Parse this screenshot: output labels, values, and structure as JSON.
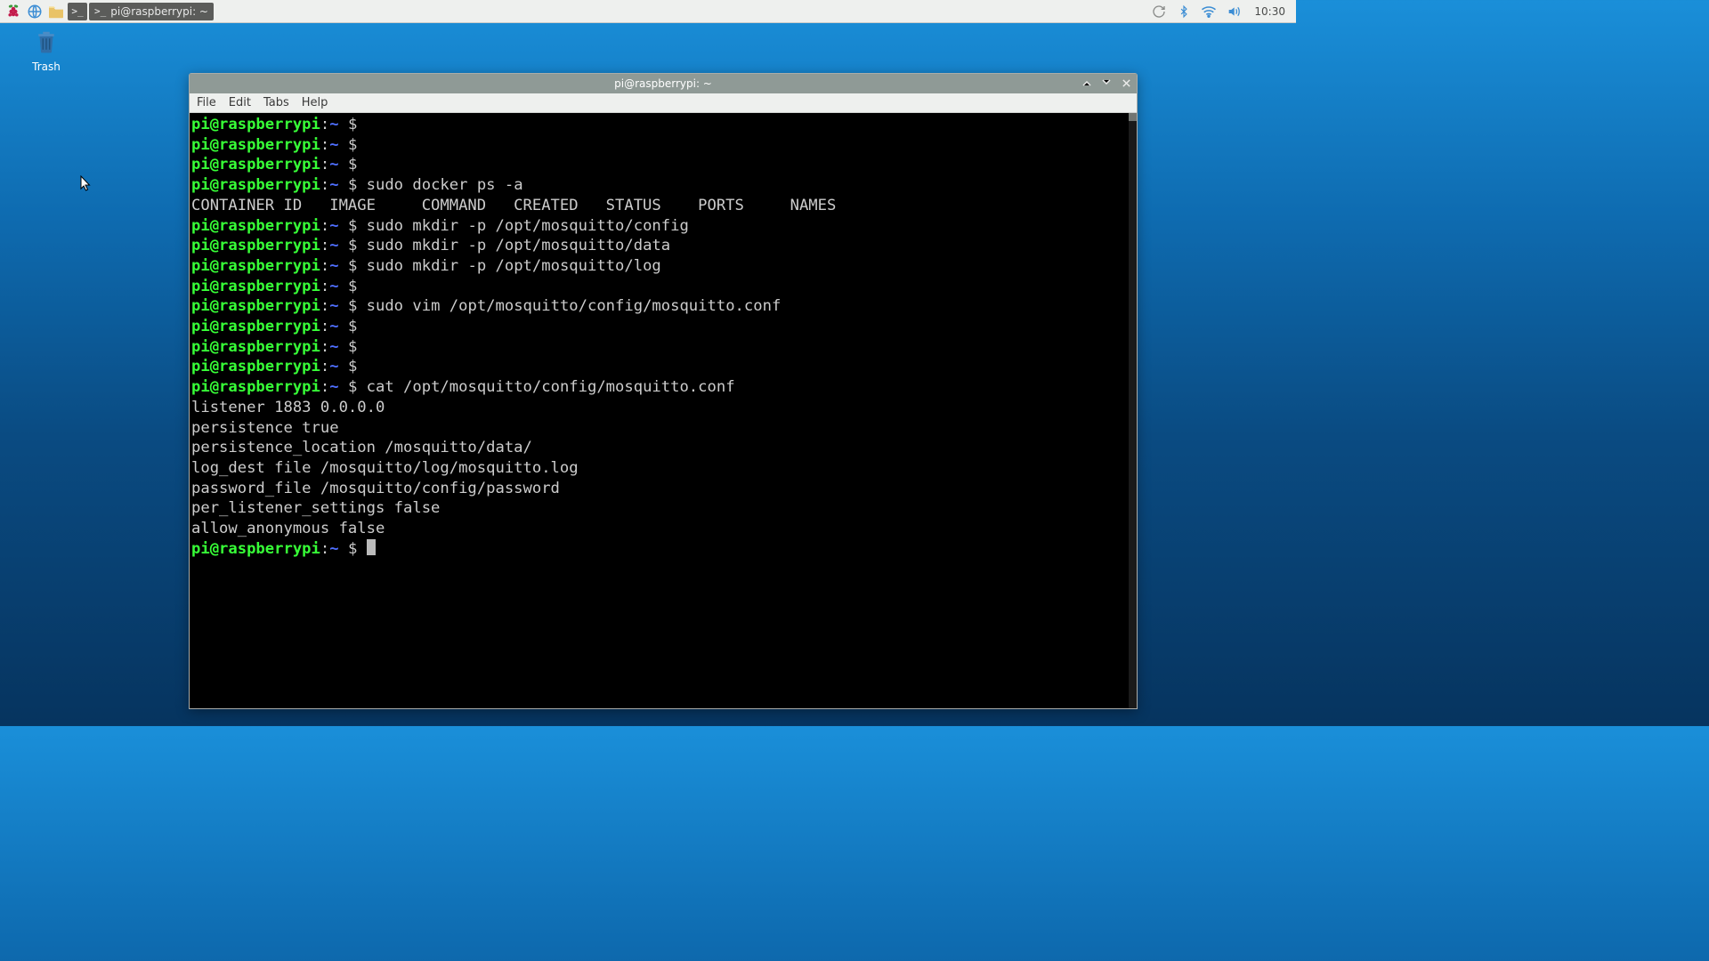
{
  "taskbar": {
    "window_title": "pi@raspberrypi: ~",
    "clock": "10:30",
    "icons": {
      "menu": "raspberry-icon",
      "browser": "globe-icon",
      "files": "folder-icon",
      "terminal": "terminal-icon"
    },
    "tray": {
      "update": "update-icon",
      "bluetooth": "bluetooth-icon",
      "wifi": "wifi-icon",
      "volume": "volume-icon"
    }
  },
  "desktop": {
    "trash_label": "Trash"
  },
  "terminal": {
    "title": "pi@raspberrypi: ~",
    "menu": {
      "file": "File",
      "edit": "Edit",
      "tabs": "Tabs",
      "help": "Help"
    },
    "prompt": {
      "user": "pi@raspberrypi",
      "sep": ":",
      "path": "~",
      "dollar": " $ "
    },
    "lines": [
      {
        "type": "prompt",
        "cmd": ""
      },
      {
        "type": "prompt",
        "cmd": ""
      },
      {
        "type": "prompt",
        "cmd": ""
      },
      {
        "type": "prompt",
        "cmd": "sudo docker ps -a"
      },
      {
        "type": "out",
        "text": "CONTAINER ID   IMAGE     COMMAND   CREATED   STATUS    PORTS     NAMES"
      },
      {
        "type": "prompt",
        "cmd": "sudo mkdir -p /opt/mosquitto/config"
      },
      {
        "type": "prompt",
        "cmd": "sudo mkdir -p /opt/mosquitto/data"
      },
      {
        "type": "prompt",
        "cmd": "sudo mkdir -p /opt/mosquitto/log"
      },
      {
        "type": "prompt",
        "cmd": ""
      },
      {
        "type": "prompt",
        "cmd": "sudo vim /opt/mosquitto/config/mosquitto.conf"
      },
      {
        "type": "prompt",
        "cmd": ""
      },
      {
        "type": "prompt",
        "cmd": ""
      },
      {
        "type": "prompt",
        "cmd": ""
      },
      {
        "type": "prompt",
        "cmd": "cat /opt/mosquitto/config/mosquitto.conf"
      },
      {
        "type": "out",
        "text": "listener 1883 0.0.0.0"
      },
      {
        "type": "out",
        "text": "persistence true"
      },
      {
        "type": "out",
        "text": "persistence_location /mosquitto/data/"
      },
      {
        "type": "out",
        "text": "log_dest file /mosquitto/log/mosquitto.log"
      },
      {
        "type": "out",
        "text": "password_file /mosquitto/config/password"
      },
      {
        "type": "out",
        "text": "per_listener_settings false"
      },
      {
        "type": "out",
        "text": "allow_anonymous false"
      },
      {
        "type": "prompt",
        "cmd": "",
        "cursor": true
      }
    ]
  }
}
